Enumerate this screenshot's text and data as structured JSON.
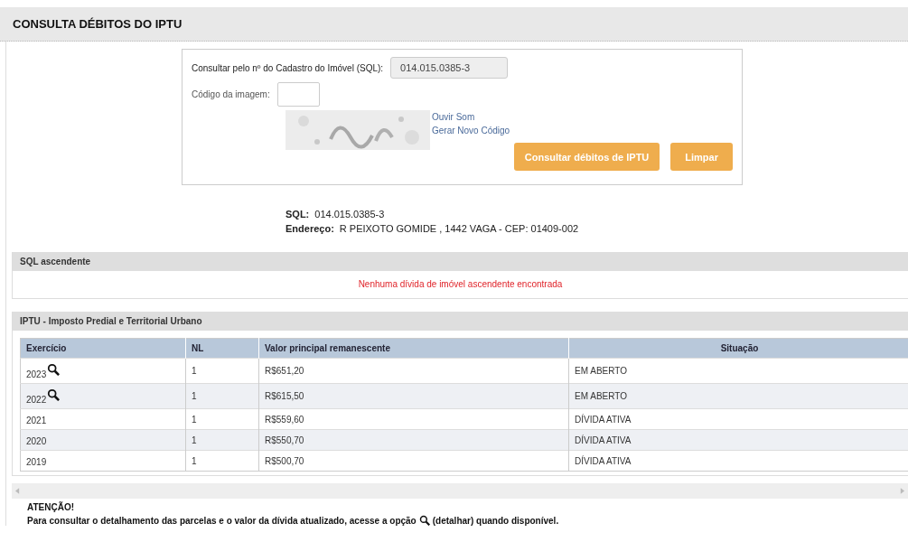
{
  "page_title": "CONSULTA DÉBITOS DO IPTU",
  "form": {
    "sql_label": "Consultar pelo nº do Cadastro do Imóvel (SQL):",
    "sql_value": "014.015.0385-3",
    "code_label": "Código da imagem:",
    "links": [
      "Ouvir Som",
      "Gerar Novo Código"
    ],
    "buttons": [
      "Consultar débitos de IPTU",
      "Limpar"
    ]
  },
  "info": [
    {
      "label": "SQL:",
      "value": "014.015.0385-3"
    },
    {
      "label": "Endereço:",
      "value": "R PEIXOTO GOMIDE , 1442 VAGA - CEP: 01409-002"
    }
  ],
  "ascendente": {
    "title": "SQL ascendente",
    "message": "Nenhuma dívida de imóvel ascendente encontrada"
  },
  "iptu": {
    "title": "IPTU - Imposto Predial e Territorial Urbano",
    "columns": [
      "Exercício",
      "NL",
      "Valor principal remanescente",
      "Situação"
    ],
    "rows": [
      {
        "exercicio": "2023",
        "detail": true,
        "nl": "1",
        "valor": "R$651,20",
        "situacao": "EM ABERTO"
      },
      {
        "exercicio": "2022",
        "detail": true,
        "nl": "1",
        "valor": "R$615,50",
        "situacao": "EM ABERTO"
      },
      {
        "exercicio": "2021",
        "detail": false,
        "nl": "1",
        "valor": "R$559,60",
        "situacao": "DÍVIDA ATIVA"
      },
      {
        "exercicio": "2020",
        "detail": false,
        "nl": "1",
        "valor": "R$550,70",
        "situacao": "DÍVIDA ATIVA"
      },
      {
        "exercicio": "2019",
        "detail": false,
        "nl": "1",
        "valor": "R$500,70",
        "situacao": "DÍVIDA ATIVA"
      }
    ]
  },
  "notice": {
    "title": "ATENÇÃO!",
    "text_before": "Para consultar o detalhamento das parcelas e o valor da dívida atualizado, acesse a opção",
    "text_after": "(detalhar) quando disponível."
  }
}
